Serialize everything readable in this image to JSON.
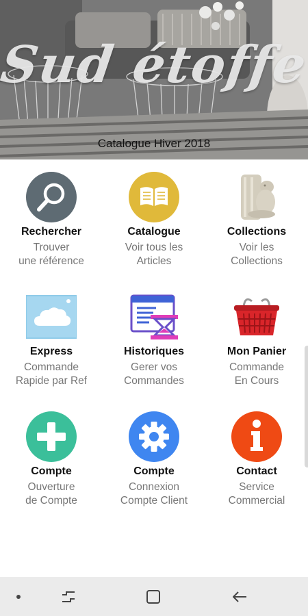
{
  "header": {
    "brand": "Sud étoffe",
    "subtitle": "Catalogue Hiver 2018"
  },
  "menu": [
    {
      "label": "Rechercher",
      "sub1": "Trouver",
      "sub2": "une référence",
      "icon": "search-icon",
      "color": "#5e6b73"
    },
    {
      "label": "Catalogue",
      "sub1": "Voir tous les",
      "sub2": "Articles",
      "icon": "book-icon",
      "color": "#e0b93a"
    },
    {
      "label": "Collections",
      "sub1": "Voir les",
      "sub2": "Collections",
      "icon": "statue-icon",
      "color": "#d9d3c4"
    },
    {
      "label": "Express",
      "sub1": "Commande",
      "sub2": "Rapide par Ref",
      "icon": "cloud-icon",
      "color": "#a6d7f0"
    },
    {
      "label": "Historiques",
      "sub1": "Gerer vos",
      "sub2": "Commandes",
      "icon": "history-icon",
      "color": "#6a4fc9"
    },
    {
      "label": "Mon Panier",
      "sub1": "Commande",
      "sub2": "En Cours",
      "icon": "basket-icon",
      "color": "#d9252a"
    },
    {
      "label": "Compte",
      "sub1": "Ouverture",
      "sub2": "de Compte",
      "icon": "plus-icon",
      "color": "#3bbf9a"
    },
    {
      "label": "Compte",
      "sub1": "Connexion",
      "sub2": "Compte Client",
      "icon": "gear-icon",
      "color": "#3f86f0"
    },
    {
      "label": "Contact",
      "sub1": "Service",
      "sub2": "Commercial",
      "icon": "info-icon",
      "color": "#ef4a14"
    }
  ],
  "navbar": {
    "icons": [
      "dot-icon",
      "recents-icon",
      "home-icon",
      "back-icon"
    ]
  }
}
